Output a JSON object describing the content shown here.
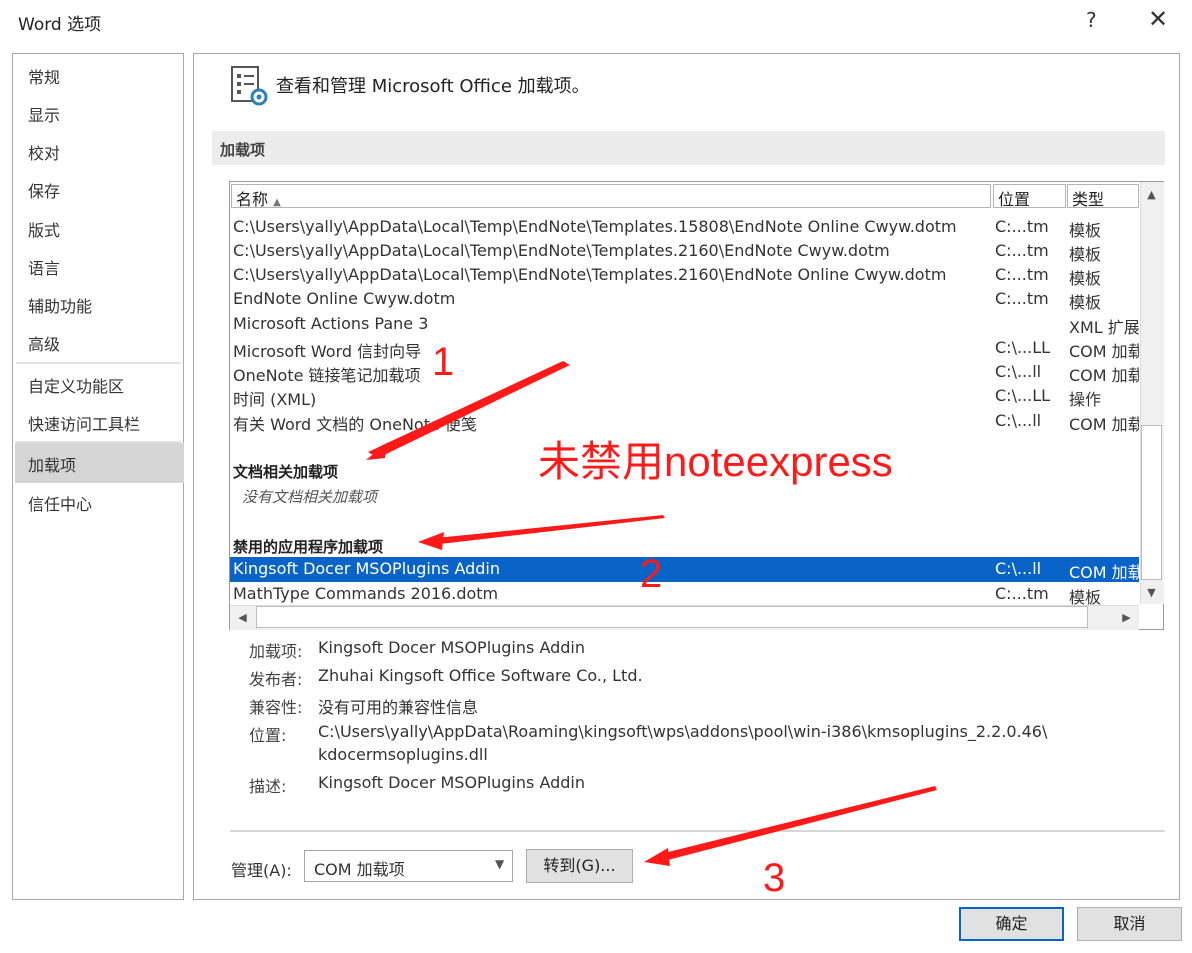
{
  "window": {
    "title": "Word 选项",
    "help": "?",
    "close": "✕"
  },
  "nav": {
    "items": [
      {
        "label": "常规"
      },
      {
        "label": "显示"
      },
      {
        "label": "校对"
      },
      {
        "label": "保存"
      },
      {
        "label": "版式"
      },
      {
        "label": "语言"
      },
      {
        "label": "辅助功能"
      },
      {
        "label": "高级"
      },
      {
        "label": "自定义功能区"
      },
      {
        "label": "快速访问工具栏"
      },
      {
        "label": "加载项",
        "selected": true
      },
      {
        "label": "信任中心"
      }
    ]
  },
  "main": {
    "header": "查看和管理 Microsoft Office 加载项。",
    "section_title": "加载项",
    "columns": {
      "name": "名称",
      "location": "位置",
      "type": "类型"
    },
    "rows": [
      {
        "name": "C:\\Users\\yally\\AppData\\Local\\Temp\\EndNote\\Templates.15808\\EndNote Online Cwyw.dotm",
        "location": "C:...tm",
        "type": "模板"
      },
      {
        "name": "C:\\Users\\yally\\AppData\\Local\\Temp\\EndNote\\Templates.2160\\EndNote Cwyw.dotm",
        "location": "C:...tm",
        "type": "模板"
      },
      {
        "name": "C:\\Users\\yally\\AppData\\Local\\Temp\\EndNote\\Templates.2160\\EndNote Online Cwyw.dotm",
        "location": "C:...tm",
        "type": "模板"
      },
      {
        "name": "EndNote Online Cwyw.dotm",
        "location": "C:...tm",
        "type": "模板"
      },
      {
        "name": "Microsoft Actions Pane 3",
        "location": "",
        "type": "XML 扩展"
      },
      {
        "name": "Microsoft Word 信封向导",
        "location": "C:\\...LL",
        "type": "COM 加载项"
      },
      {
        "name": "OneNote 链接笔记加载项",
        "location": "C:\\...ll",
        "type": "COM 加载项"
      },
      {
        "name": "时间 (XML)",
        "location": "C:\\...LL",
        "type": "操作"
      },
      {
        "name": "有关 Word 文档的 OneNote 便笺",
        "location": "C:\\...ll",
        "type": "COM 加载项"
      }
    ],
    "group_doc": "文档相关加载项",
    "group_doc_empty": "没有文档相关加载项",
    "group_disabled": "禁用的应用程序加载项",
    "disabled_rows": [
      {
        "name": "Kingsoft Docer MSOPlugins Addin",
        "location": "C:\\...ll",
        "type": "COM 加载项",
        "selected": true
      },
      {
        "name": "MathType Commands 2016.dotm",
        "location": "C:...tm",
        "type": "模板"
      }
    ],
    "details": {
      "addin_label": "加载项:",
      "addin": "Kingsoft Docer MSOPlugins Addin",
      "publisher_label": "发布者:",
      "publisher": "Zhuhai Kingsoft Office Software Co., Ltd.",
      "compat_label": "兼容性:",
      "compat": "没有可用的兼容性信息",
      "location_label": "位置:",
      "location_line1": "C:\\Users\\yally\\AppData\\Roaming\\kingsoft\\wps\\addons\\pool\\win-i386\\kmsoplugins_2.2.0.46\\",
      "location_line2": "kdocermsoplugins.dll",
      "desc_label": "描述:",
      "desc": "Kingsoft Docer MSOPlugins Addin"
    },
    "manage_label": "管理(A):",
    "manage_value": "COM 加载项",
    "go_button": "转到(G)..."
  },
  "footer": {
    "ok": "确定",
    "cancel": "取消"
  },
  "annotations": {
    "n1": "1",
    "n2": "2",
    "n3": "3",
    "note": "未禁用noteexpress",
    "color": "#ff1a1a"
  }
}
